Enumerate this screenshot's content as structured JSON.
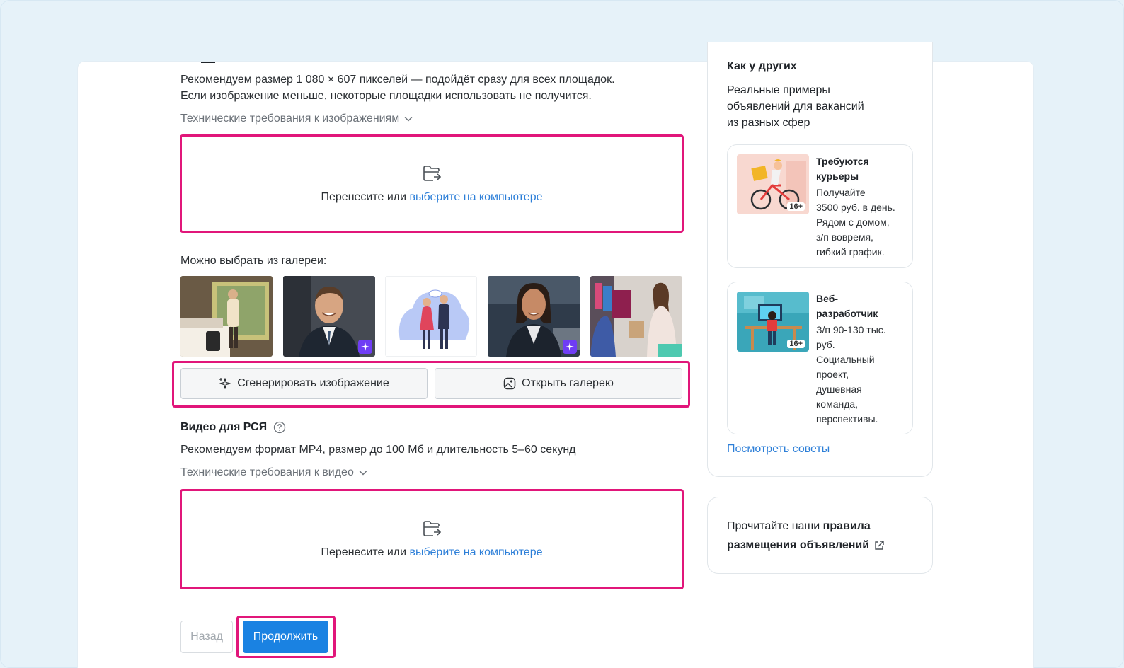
{
  "image_section": {
    "recommend_line1": "Рекомендуем размер 1 080 × 607 пикселей — подойдёт сразу для всех площадок.",
    "recommend_line2": "Если изображение меньше, некоторые площадки использовать не получится.",
    "tech_requirements": "Технические требования к изображениям",
    "dropzone_text": "Перенесите или",
    "dropzone_link": "выберите на компьютере",
    "gallery_label": "Можно выбрать из галереи:",
    "generate_button": "Сгенерировать изображение",
    "open_gallery_button": "Открыть галерею"
  },
  "video_section": {
    "title": "Видео для РСЯ",
    "recommend": "Рекомендуем формат MP4, размер до 100 Мб и длительность 5–60 секунд",
    "tech_requirements": "Технические требования к видео",
    "dropzone_text": "Перенесите или",
    "dropzone_link": "выберите на компьютере"
  },
  "footer": {
    "back": "Назад",
    "continue": "Продолжить"
  },
  "sidebar": {
    "heading": "Как у других",
    "subheading_l1": "Реальные примеры",
    "subheading_l2": "объявлений для вакансий",
    "subheading_l3": "из разных сфер",
    "examples": [
      {
        "title_l1": "Требуются",
        "title_l2": "курьеры",
        "body": [
          "Получайте",
          "3500 руб. в день.",
          "Рядом с домом,",
          "з/п вовремя,",
          "гибкий график."
        ],
        "age": "16+"
      },
      {
        "title_l1": "Веб-",
        "title_l2": "разработчик",
        "body": [
          "З/п 90-130 тыс.",
          "руб.",
          "Социальный",
          "проект,",
          "душевная",
          "команда,",
          "перспективы."
        ],
        "age": "16+"
      }
    ],
    "tips_link": "Посмотреть советы",
    "rules_prefix": "Прочитайте наши ",
    "rules_bold_l1": "правила",
    "rules_bold_l2": "размещения объявлений"
  },
  "colors": {
    "highlight": "#e1167a",
    "primary": "#1a82e2",
    "link": "#2d7fd8",
    "background": "#e6f2f9"
  },
  "icons": [
    "folder-upload-icon",
    "chevron-down-icon",
    "sparkle-icon",
    "image-icon",
    "help-circle-icon",
    "external-link-icon",
    "ai-badge-icon"
  ]
}
